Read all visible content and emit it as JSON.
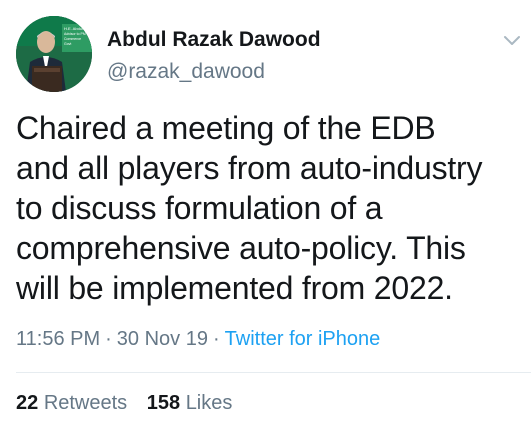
{
  "user": {
    "display_name": "Abdul Razak Dawood",
    "handle": "@razak_dawood",
    "avatar_caption": "H.E. Abdul Advisor to the Prime Minister Commerce Textile Industry of Govt"
  },
  "tweet": {
    "text_lines": [
      "Chaired a meeting of the EDB",
      "and all players from auto-industry",
      "to discuss formulation of a",
      "comprehensive auto-policy. This",
      "will be implemented from 2022."
    ],
    "time": "11:56 PM",
    "date": "30 Nov 19",
    "separator": "·",
    "source": "Twitter for iPhone"
  },
  "stats": {
    "retweets_count": "22",
    "retweets_label": "Retweets",
    "likes_count": "158",
    "likes_label": "Likes"
  },
  "icons": {
    "menu": "chevron-down-icon"
  },
  "colors": {
    "link": "#1da1f2",
    "secondary_text": "#657786",
    "primary_text": "#14171a",
    "divider": "#e6ecf0"
  }
}
